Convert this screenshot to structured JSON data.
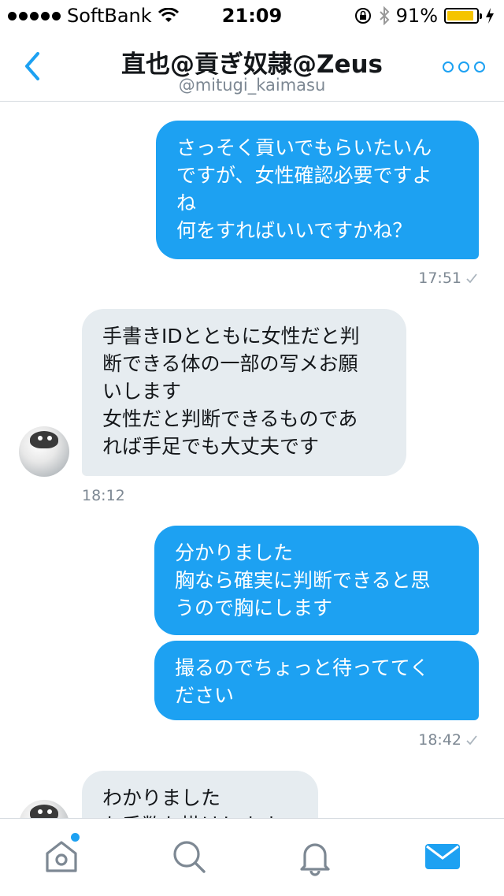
{
  "status_bar": {
    "carrier": "SoftBank",
    "time": "21:09",
    "battery_percent": "91%",
    "battery_level": 0.91
  },
  "header": {
    "title": "直也@貢ぎ奴隷@Zeus",
    "handle": "@mitugi_kaimasu"
  },
  "messages": [
    {
      "direction": "sent",
      "text": "さっそく貢いでもらいたいん\nですが、女性確認必要ですよ\nね\n何をすればいいですかね？"
    },
    {
      "direction": "sent",
      "time": "17:51"
    },
    {
      "direction": "received",
      "text": "手書きIDとともに女性だと判\n断できる体の一部の写メお願\nいします\n女性だと判断できるものであ\nれば手足でも大丈夫です",
      "time": "18:12"
    },
    {
      "direction": "sent",
      "text": "分かりました\n胸なら確実に判断できると思\nうので胸にします"
    },
    {
      "direction": "sent",
      "text": "撮るのでちょっと待っててく\nださい",
      "time": "18:42"
    },
    {
      "direction": "received",
      "text": "わかりました\nお手数お掛けします"
    }
  ],
  "tabbar": {
    "items": [
      "home-icon",
      "search-icon",
      "notifications-icon",
      "messages-icon"
    ],
    "active": "messages-icon",
    "has_new_home": true
  },
  "colors": {
    "accent": "#1da1f2",
    "received_bubble": "#e6ecf0",
    "meta_text": "#7d8893"
  }
}
